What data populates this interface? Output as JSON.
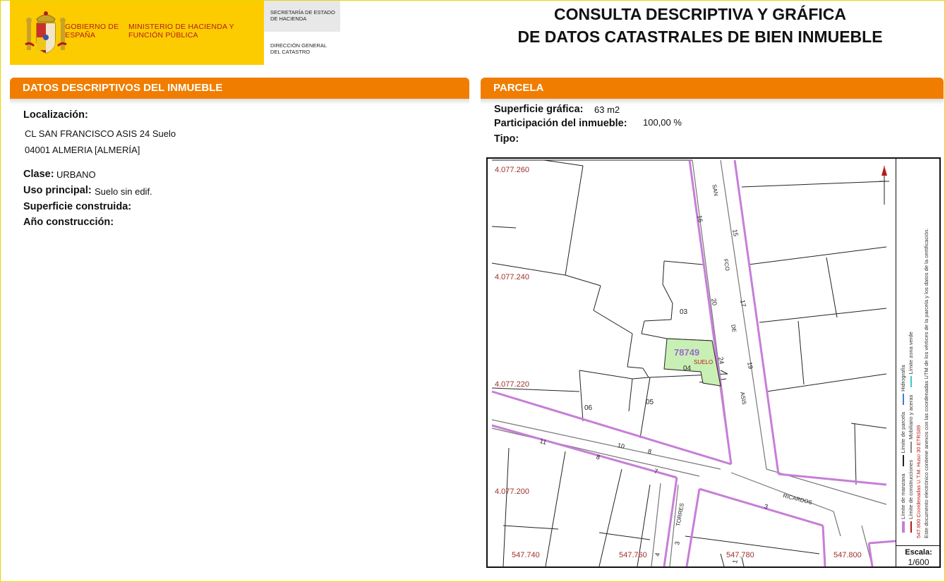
{
  "header": {
    "gov_line": "GOBIERNO DE ESPAÑA",
    "ministry": "MINISTERIO DE HACIENDA Y FUNCIÓN PÚBLICA",
    "secretaria": "SECRETARÍA DE ESTADO DE HACIENDA",
    "direccion": "DIRECCIÓN GENERAL DEL CATASTRO",
    "title_line1": "CONSULTA DESCRIPTIVA Y GRÁFICA",
    "title_line2": "DE DATOS CATASTRALES DE BIEN INMUEBLE"
  },
  "left_panel": {
    "header_prefix": "DATOS DESCRIPTIVOS DEL ",
    "header_highlight": "INMUEBLE",
    "localizacion_label": "Localización:",
    "address_line1": "CL SAN FRANCISCO ASIS 24 Suelo",
    "address_line2": "04001 ALMERIA [ALMERÍA]",
    "clase_label": "Clase:",
    "clase_value": "URBANO",
    "uso_label": "Uso principal:",
    "uso_value": "Suelo sin edif.",
    "superficie_label": "Superficie construida:",
    "anio_label": "Año construcción:"
  },
  "right_panel": {
    "header": "PARCELA",
    "superficie_label": "Superficie gráfica:",
    "superficie_value": "63 m2",
    "participacion_label": "Participación del inmueble:",
    "participacion_value": "100,00 %",
    "tipo_label": "Tipo:"
  },
  "map": {
    "y_coords": [
      "4.077.260",
      "4.077.240",
      "4.077.220",
      "4.077.200"
    ],
    "x_coords": [
      "547.740",
      "547.760",
      "547.780",
      "547.800"
    ],
    "parcel_ref": "78749",
    "parcel_use": "SUELO",
    "labels": {
      "n03": "03",
      "n04": "04",
      "n05": "05",
      "n06": "06",
      "san": "SAN",
      "fco": "FCO",
      "de": "DE",
      "asis": "ASIS",
      "n16": "16",
      "n15": "15",
      "n20": "20",
      "n17": "17",
      "n24": "24",
      "n19": "19",
      "n11": "11",
      "n10": "10",
      "n8a": "8",
      "n8b": "8",
      "n7": "7",
      "n3": "3",
      "n3b": "3",
      "n4": "4",
      "n1": "1",
      "ricardos": "RICARDOS",
      "torres": "TORRES"
    },
    "legend": {
      "limite_manzana": "Límite de manzana",
      "limite_parcela": "Límite de parcela",
      "hidrografia": "Hidrografía",
      "limite_construcciones": "Límite de construcciones",
      "mobiliario": "Mobiliario y aceras",
      "limite_zona_verde": "Límite zona verde",
      "coordenadas": "547.800 Coordenadas U.T.M. Huso 30 ETRS89",
      "nota": "Este documento electrónico contiene anexos con las coordenadas UTM de los vértices de la parcela y los datos de la certificación."
    },
    "escala_label": "Escala:",
    "escala_value": "1/600"
  },
  "colors": {
    "orange": "#f07d00",
    "gov_yellow": "#fccc00",
    "gov_red": "#b31b1b",
    "manzana": "#c77ed8",
    "parcel_fill": "#c9f0b4"
  }
}
